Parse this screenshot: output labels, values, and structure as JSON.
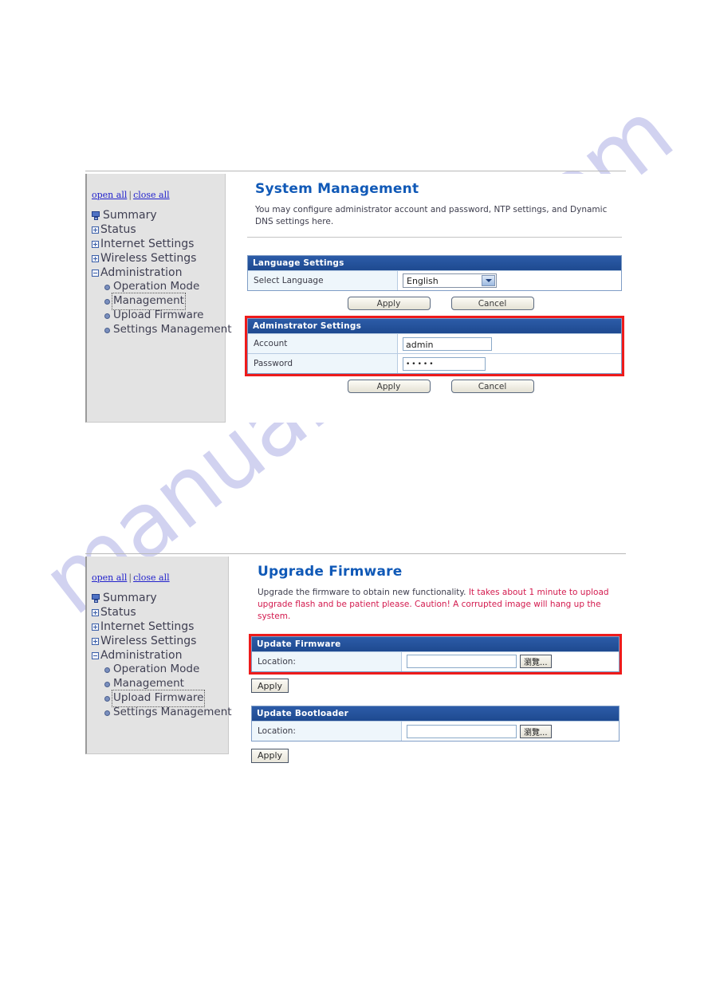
{
  "sidebar": {
    "open_all": "open all",
    "close_all": "close all",
    "separator": "|",
    "items": [
      {
        "label": "Summary",
        "icon": "monitor-icon",
        "level": 0,
        "state": "leaf"
      },
      {
        "label": "Status",
        "icon": "plus-box-icon",
        "level": 0,
        "state": "collapsed"
      },
      {
        "label": "Internet Settings",
        "icon": "plus-box-icon",
        "level": 0,
        "state": "collapsed"
      },
      {
        "label": "Wireless Settings",
        "icon": "plus-box-icon",
        "level": 0,
        "state": "collapsed"
      },
      {
        "label": "Administration",
        "icon": "minus-box-icon",
        "level": 0,
        "state": "expanded"
      },
      {
        "label": "Operation Mode",
        "icon": "bullet-icon",
        "level": 1,
        "state": "leaf"
      },
      {
        "label": "Management",
        "icon": "bullet-icon",
        "level": 1,
        "state": "leaf"
      },
      {
        "label": "Upload Firmware",
        "icon": "bullet-icon",
        "level": 1,
        "state": "leaf"
      },
      {
        "label": "Settings Management",
        "icon": "bullet-icon",
        "level": 1,
        "state": "leaf"
      }
    ]
  },
  "screen1": {
    "title": "System Management",
    "description": "You may configure administrator account and password, NTP settings, and Dynamic DNS settings here.",
    "selected_nav": "Management",
    "language_panel": {
      "header": "Language Settings",
      "row_label": "Select Language",
      "selected_value": "English",
      "options": [
        "English"
      ],
      "apply_label": "Apply",
      "cancel_label": "Cancel"
    },
    "admin_panel": {
      "header": "Adminstrator Settings",
      "highlighted": true,
      "rows": [
        {
          "label": "Account",
          "value": "admin",
          "type": "text"
        },
        {
          "label": "Password",
          "value": "•••••",
          "type": "password"
        }
      ],
      "apply_label": "Apply",
      "cancel_label": "Cancel"
    }
  },
  "screen2": {
    "title": "Upgrade Firmware",
    "description_normal": "Upgrade the firmware to obtain new functionality. ",
    "description_warning": "It takes about 1 minute to upload   upgrade flash and be patient please. Caution! A corrupted image will hang up the system.",
    "selected_nav": "Upload Firmware",
    "firmware_panel": {
      "header": "Update Firmware",
      "highlighted": true,
      "row_label": "Location:",
      "field_value": "",
      "browse_label": "瀏覽...",
      "apply_label": "Apply"
    },
    "bootloader_panel": {
      "header": "Update Bootloader",
      "highlighted": false,
      "row_label": "Location:",
      "field_value": "",
      "browse_label": "瀏覽...",
      "apply_label": "Apply"
    }
  },
  "watermark": {
    "text": "manualshive.com"
  },
  "colors": {
    "accent_blue": "#1059b7",
    "panel_header": "#27559e",
    "highlight_red": "#ee1b1b",
    "warning_text": "#d31a4e",
    "link_blue": "#2222cc",
    "sidebar_bg": "#e3e3e3"
  }
}
